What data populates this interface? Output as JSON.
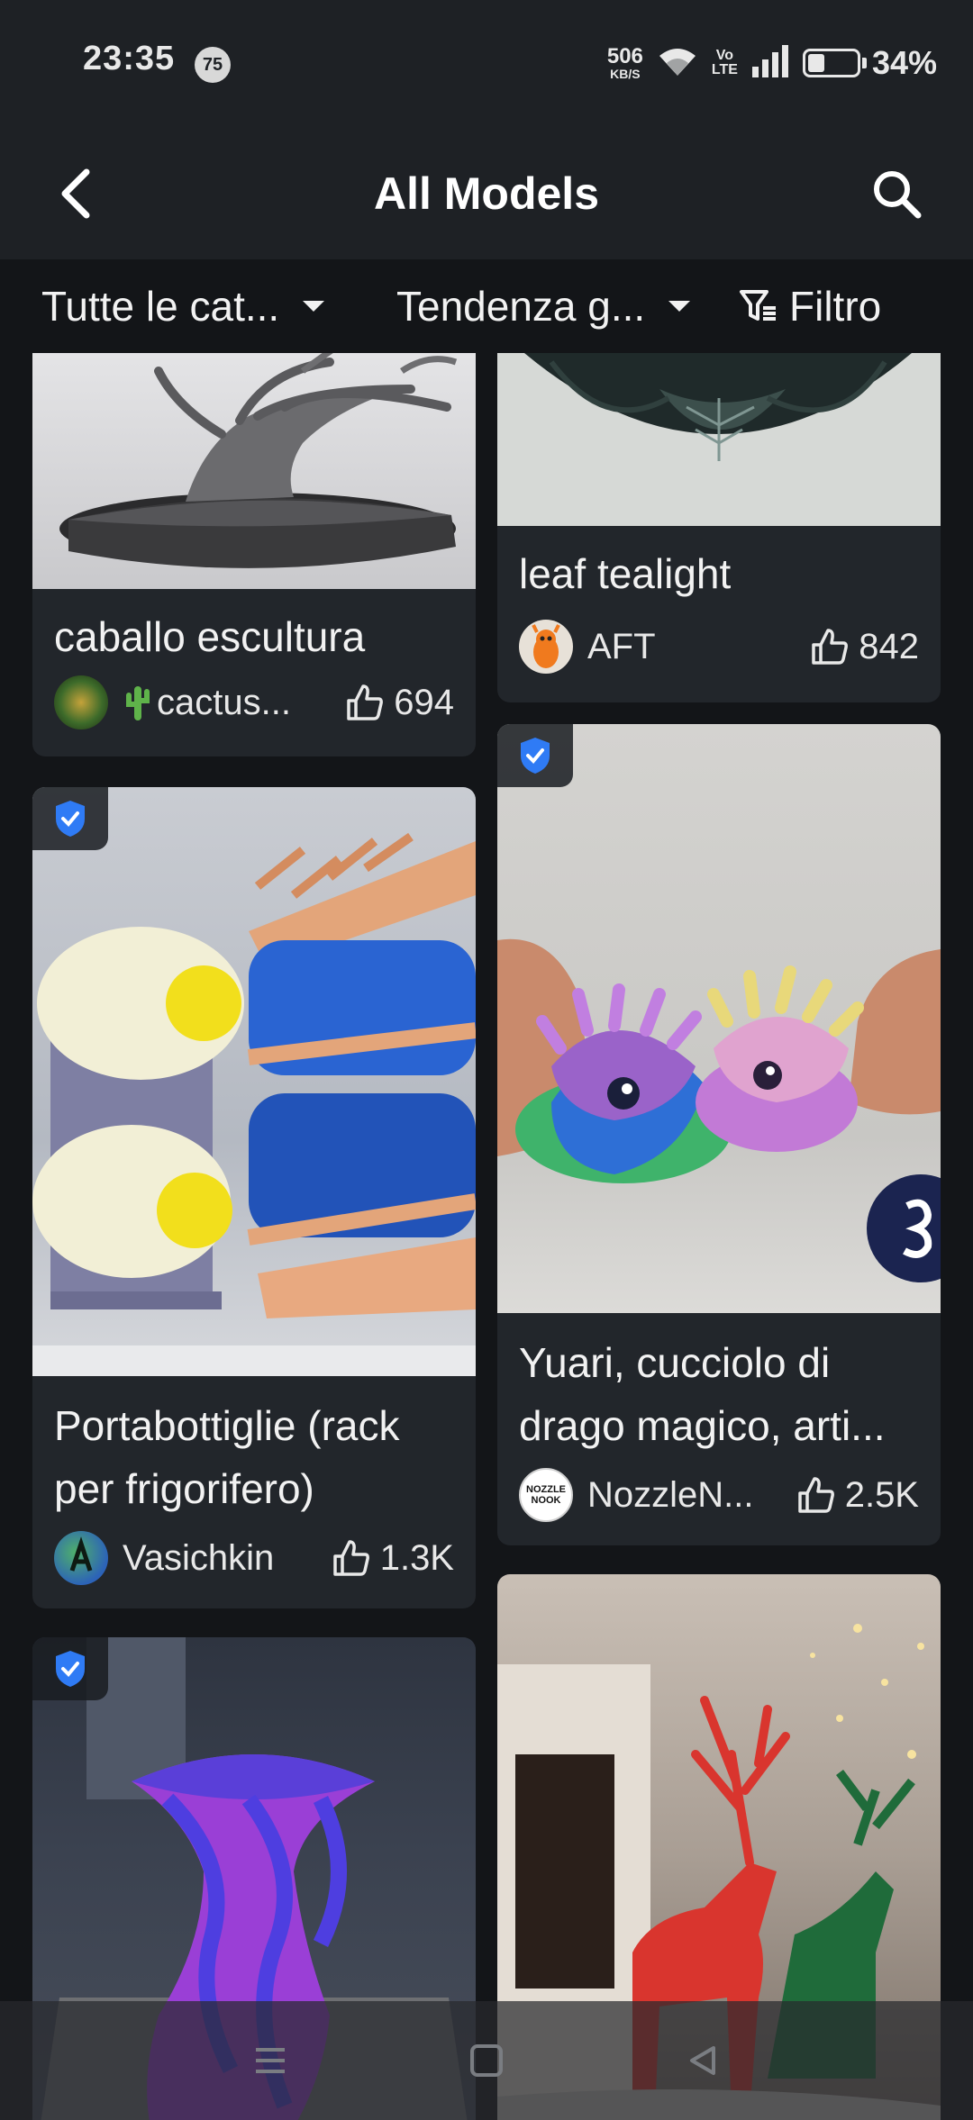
{
  "status_bar": {
    "time": "23:35",
    "notification_count": "75",
    "net_speed_value": "506",
    "net_speed_unit": "KB/S",
    "volte_top": "Vo",
    "volte_bottom": "LTE",
    "battery_percent": "34%",
    "battery_level": 0.34
  },
  "app_bar": {
    "title": "All Models",
    "back_icon": "back-arrow-icon",
    "search_icon": "search-icon"
  },
  "filters": {
    "category_label": "Tutte le cat...",
    "sort_label": "Tendenza g...",
    "filter_label": "Filtro"
  },
  "cards": [
    {
      "title": "caballo escultura",
      "author": "cactus...",
      "author_prefix_icon": "cactus-icon",
      "likes": "694",
      "verified": false
    },
    {
      "title": "leaf tealight",
      "author": "AFT",
      "likes": "842",
      "verified": false
    },
    {
      "title": "Portabottiglie (rack per frigorifero)",
      "author": "Vasichkin",
      "likes": "1.3K",
      "verified": true
    },
    {
      "title": "Yuari, cucciolo di drago magico, arti...",
      "author": "NozzleN...",
      "avatar_text": "NOZZLE NOOK",
      "likes": "2.5K",
      "verified": true
    },
    {
      "title": "",
      "author": "",
      "likes": "",
      "verified": true
    },
    {
      "title": "",
      "author": "",
      "likes": "",
      "verified": false
    }
  ],
  "colors": {
    "background": "#131518",
    "bar": "#1e2125",
    "card": "#22262b",
    "verified_blue": "#2f7bf5"
  }
}
